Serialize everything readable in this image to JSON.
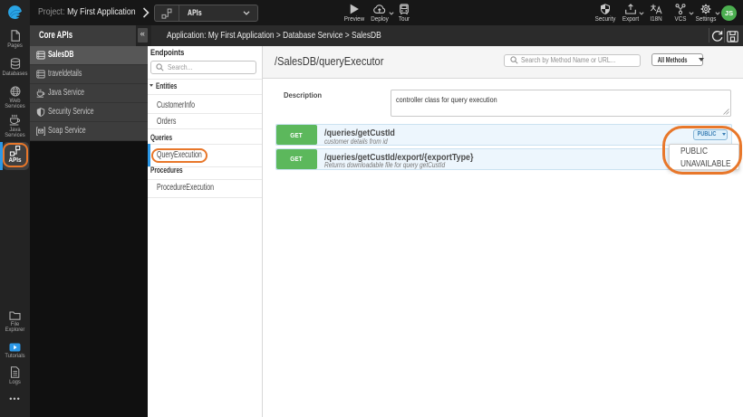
{
  "topbar": {
    "project_label": "Project:",
    "project_name": "My First Application",
    "selector_label": "APIs",
    "preview_label": "Preview",
    "deploy_label": "Deploy",
    "tour_label": "Tour",
    "security_label": "Security",
    "export_label": "Export",
    "i18n_label": "I18N",
    "vcs_label": "VCS",
    "settings_label": "Settings",
    "avatar_initials": "JS"
  },
  "rail": {
    "pages": "Pages",
    "databases": "Databases",
    "web_services": "Web Services",
    "java_services": "Java Services",
    "apis": "APIs",
    "file_explorer": "File Explorer",
    "tutorials": "Tutorials",
    "logs": "Logs",
    "more": "•••"
  },
  "core_apis": {
    "title": "Core APIs",
    "collapse_glyph": "«",
    "items": [
      {
        "label": "SalesDB",
        "icon": "database",
        "selected": true
      },
      {
        "label": "traveldetails",
        "icon": "database",
        "selected": false
      },
      {
        "label": "Java Service",
        "icon": "coffee",
        "selected": false
      },
      {
        "label": "Security Service",
        "icon": "shield",
        "selected": false
      },
      {
        "label": "Soap Service",
        "icon": "envelope",
        "selected": false
      }
    ]
  },
  "breadcrumb": "Application: My First Application > Database Service > SalesDB",
  "endpoints": {
    "title": "Endpoints",
    "search_placeholder": "Search...",
    "entities_header": "Entities",
    "items": {
      "customerinfo": "CustomerInfo",
      "orders": "Orders",
      "queries_header": "Queries",
      "queryexecution": "QueryExecution",
      "procedures_header": "Procedures",
      "procedureexecution": "ProcedureExecution"
    }
  },
  "main": {
    "title": "/SalesDB/queryExecutor",
    "search_placeholder": "Search by Method Name or URL...",
    "methods_filter_label": "All Methods",
    "description_label": "Description",
    "description_value": "controller class for query execution",
    "operations": [
      {
        "method": "GET",
        "path": "/queries/getCustId",
        "summary": "customer details from id",
        "badge": "PUBLIC"
      },
      {
        "method": "GET",
        "path": "/queries/getCustId/export/{exportType}",
        "summary": "Returns downloadable file for query getCustId"
      }
    ],
    "visibility_menu": [
      "PUBLIC",
      "UNAVAILABLE"
    ]
  },
  "colors": {
    "annotation_orange": "#e8772a",
    "selection_blue": "#2b97e6",
    "method_green": "#5cb85c",
    "avatar_green": "#4caf50"
  }
}
